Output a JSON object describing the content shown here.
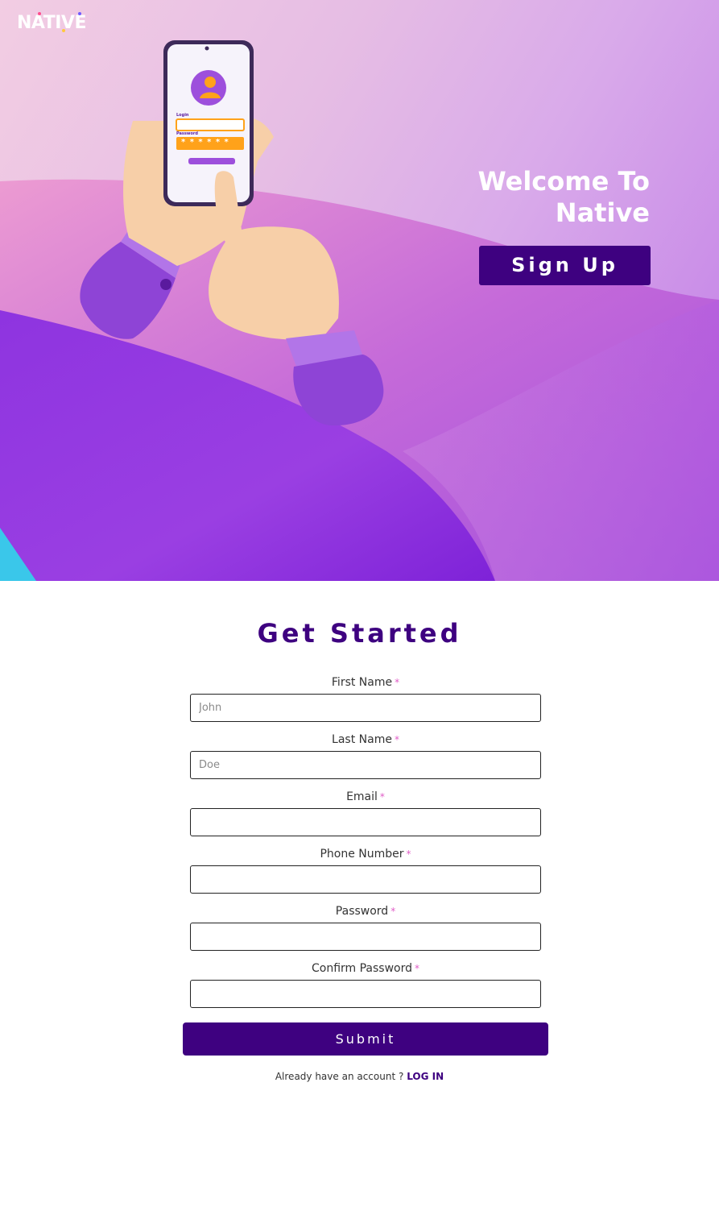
{
  "brand": {
    "logo_text": "NATIVE"
  },
  "hero": {
    "welcome_line1": "Welcome To",
    "welcome_line2": "Native",
    "signup_label": "Sign Up",
    "phone_login_label": "Login",
    "phone_password_label": "Password",
    "phone_password_mask": "* * * * * *"
  },
  "form": {
    "title": "Get Started",
    "required_mark": "*",
    "fields": [
      {
        "label": "First Name",
        "placeholder": "John",
        "value": ""
      },
      {
        "label": "Last Name",
        "placeholder": "Doe",
        "value": ""
      },
      {
        "label": "Email",
        "placeholder": "",
        "value": ""
      },
      {
        "label": "Phone Number",
        "placeholder": "",
        "value": ""
      },
      {
        "label": "Password",
        "placeholder": "",
        "value": ""
      },
      {
        "label": "Confirm Password",
        "placeholder": "",
        "value": ""
      }
    ],
    "submit_label": "Submit",
    "login_prompt": "Already have an account ?",
    "login_link": "LOG IN"
  },
  "colors": {
    "accent": "#3e0180",
    "required": "#e05cc7",
    "hero_violet": "#8a2be2",
    "hero_pink": "#f2cde3"
  }
}
